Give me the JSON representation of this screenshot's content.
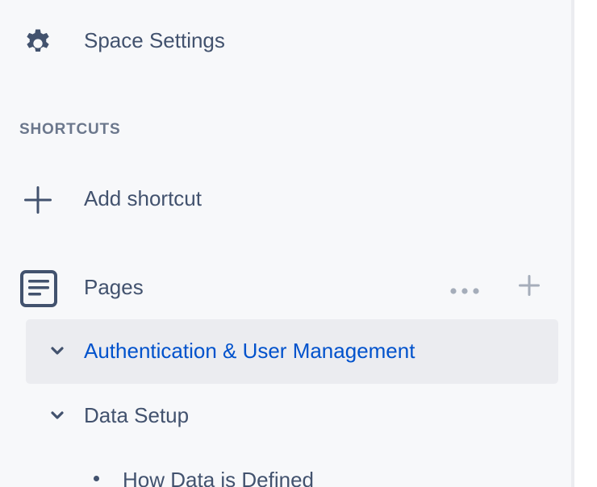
{
  "sidebar": {
    "settings": {
      "label": "Space Settings",
      "icon": "gear-icon"
    },
    "shortcuts_heading": "SHORTCUTS",
    "add_shortcut": {
      "label": "Add shortcut",
      "icon": "plus-icon"
    },
    "pages": {
      "label": "Pages",
      "icon": "document-icon",
      "more_actions_icon": "more-horizontal-icon",
      "add_page_icon": "plus-icon"
    },
    "tree": [
      {
        "label": "Authentication & User Management",
        "selected": true,
        "expanded": true
      },
      {
        "label": "Data Setup",
        "selected": false,
        "expanded": true
      }
    ],
    "tree_children": [
      {
        "label": "How Data is Defined"
      }
    ]
  },
  "colors": {
    "sidebar_bg": "#f7f8fa",
    "text": "#42526e",
    "selected_bg": "#ebecf0",
    "selected_text": "#0052cc",
    "muted_icon": "#a5adba"
  }
}
